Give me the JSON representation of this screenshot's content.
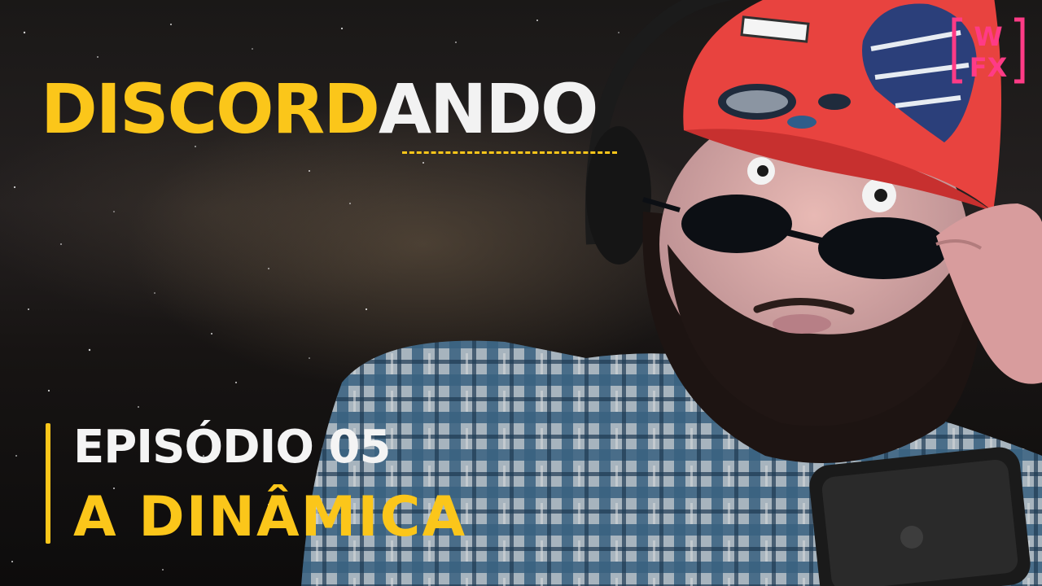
{
  "title": {
    "part1": "DISCORD",
    "part2": "ANDO"
  },
  "episode": {
    "line1": "EPISÓDIO 05",
    "line2": "A DINÂMICA"
  },
  "colors": {
    "accent": "#fbc61a",
    "title_white": "#f2f2f2",
    "cap_red": "#e8433f",
    "badge_pink": "#ff3b86"
  }
}
